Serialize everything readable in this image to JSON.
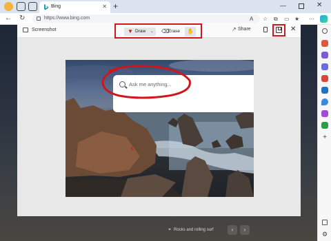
{
  "browser": {
    "tab": {
      "title": "Bing",
      "close_icon": "close-icon"
    },
    "address": {
      "url": "https://www.bing.com"
    }
  },
  "screenshot_tool": {
    "title": "Screenshot",
    "draw_label": "Draw",
    "erase_label": "Erase",
    "share_label": "Share"
  },
  "captured_image": {
    "search_placeholder": "Ask me anything..."
  },
  "wallpaper": {
    "caption": "Rocks and rolling surf"
  },
  "colors": {
    "annotation_red": "#d0161c",
    "bing_teal": "#1ba1b4"
  }
}
